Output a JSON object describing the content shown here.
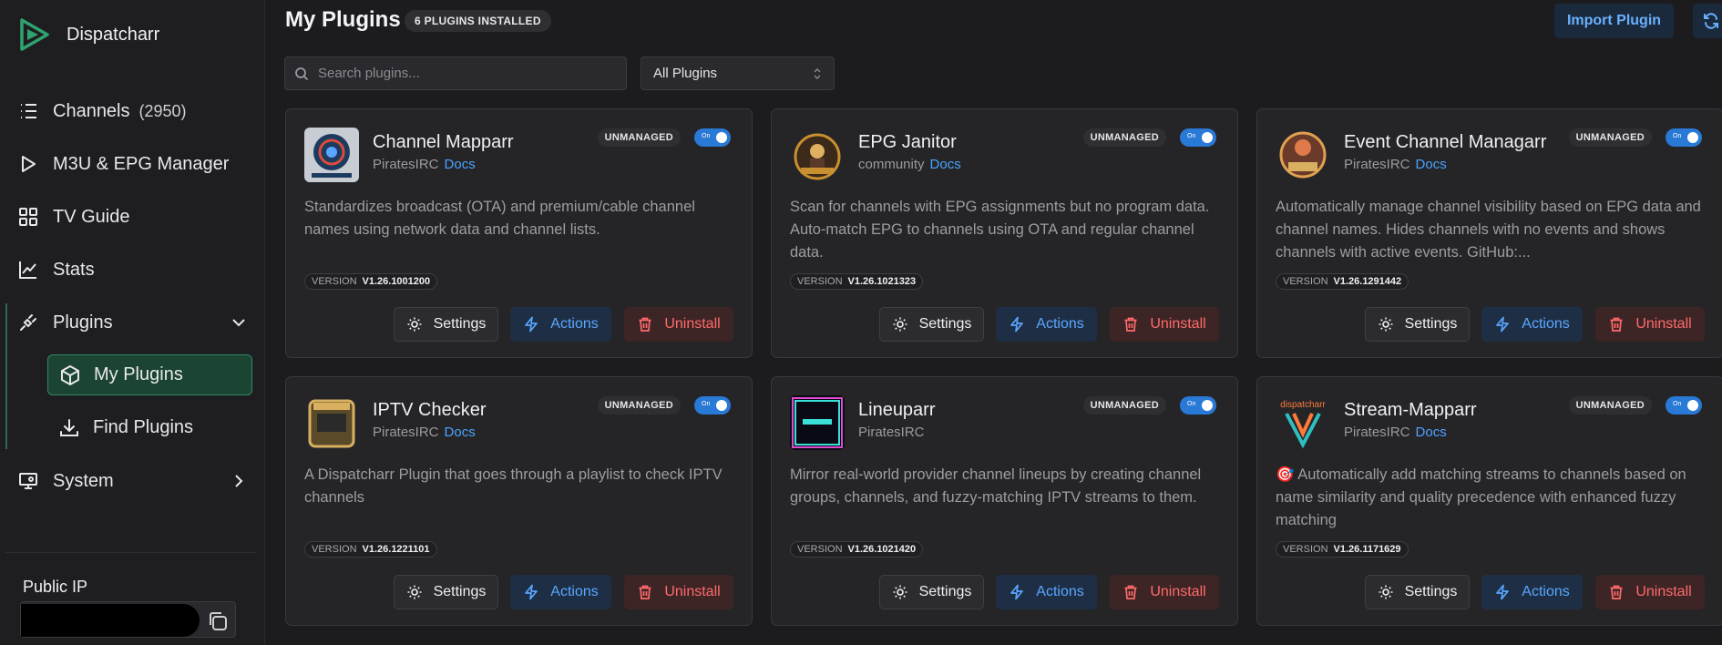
{
  "sidebar": {
    "brand": "Dispatcharr",
    "nav": [
      {
        "label": "Channels",
        "count": "(2950)",
        "icon": "list-icon"
      },
      {
        "label": "M3U & EPG Manager",
        "icon": "play-icon"
      },
      {
        "label": "TV Guide",
        "icon": "grid-icon"
      },
      {
        "label": "Stats",
        "icon": "chart-icon"
      },
      {
        "label": "Plugins",
        "icon": "plug-icon"
      },
      {
        "label": "System",
        "icon": "monitor-icon"
      }
    ],
    "sub": [
      {
        "label": "My Plugins",
        "icon": "box-icon"
      },
      {
        "label": "Find Plugins",
        "icon": "download-icon"
      }
    ],
    "public_ip_label": "Public IP"
  },
  "header": {
    "title": "My Plugins",
    "badge": "6 PLUGINS INSTALLED",
    "import_label": "Import Plugin"
  },
  "filters": {
    "search_placeholder": "Search plugins...",
    "filter_value": "All Plugins"
  },
  "card_labels": {
    "unmanaged": "UNMANAGED",
    "toggle": "On",
    "version": "VERSION",
    "docs": "Docs",
    "settings": "Settings",
    "actions": "Actions",
    "uninstall": "Uninstall"
  },
  "plugins": [
    {
      "name": "Channel Mapparr",
      "author": "PiratesIRC",
      "docs": true,
      "desc": "Standardizes broadcast (OTA) and premium/cable channel names using network data and channel lists.",
      "version": "V1.26.1001200"
    },
    {
      "name": "EPG Janitor",
      "author": "community",
      "docs": true,
      "desc": "Scan for channels with EPG assignments but no program data. Auto-match EPG to channels using OTA and regular channel data.",
      "version": "V1.26.1021323"
    },
    {
      "name": "Event Channel Managarr",
      "author": "PiratesIRC",
      "docs": true,
      "desc": "Automatically manage channel visibility based on EPG data and channel names. Hides channels with no events and shows channels with active events. GitHub:...",
      "version": "V1.26.1291442"
    },
    {
      "name": "IPTV Checker",
      "author": "PiratesIRC",
      "docs": true,
      "desc": "A Dispatcharr Plugin that goes through a playlist to check IPTV channels",
      "version": "V1.26.1221101"
    },
    {
      "name": "Lineuparr",
      "author": "PiratesIRC",
      "docs": false,
      "desc": "Mirror real-world provider channel lineups by creating channel groups, channels, and fuzzy-matching IPTV streams to them.",
      "version": "V1.26.1021420"
    },
    {
      "name": "Stream-Mapparr",
      "author": "PiratesIRC",
      "docs": true,
      "desc": "🎯 Automatically add matching streams to channels based on name similarity and quality precedence with enhanced fuzzy matching",
      "version": "V1.26.1171629"
    }
  ],
  "colors": {
    "accent_green": "#2f8a63",
    "accent_blue": "#2979d6",
    "danger": "#ff6b6b"
  }
}
